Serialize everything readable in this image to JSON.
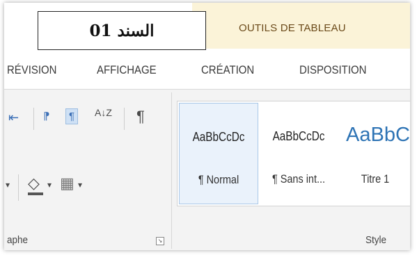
{
  "header": {
    "doc_label": "السند 01",
    "tools_title": "OUTILS DE TABLEAU"
  },
  "tabs": [
    {
      "label": "RÉVISION"
    },
    {
      "label": "AFFICHAGE"
    },
    {
      "label": "CRÉATION"
    },
    {
      "label": "DISPOSITION"
    }
  ],
  "paragraph_group": {
    "label": "aphe",
    "icons": {
      "decrease_indent": "⇤",
      "ltr": "⁋",
      "rtl": "¶",
      "sort": "A↓Z",
      "show_marks": "¶",
      "dropdown": "▾",
      "shading": "◇",
      "borders": "▦",
      "launcher": "↘"
    }
  },
  "styles_group": {
    "label": "Style",
    "items": [
      {
        "sample": "AaBbCcDc",
        "name": "¶ Normal",
        "selected": true
      },
      {
        "sample": "AaBbCcDc",
        "name": "¶ Sans int...",
        "selected": false
      },
      {
        "sample": "AaBbCc",
        "name": "Titre 1",
        "selected": false
      }
    ]
  },
  "colors": {
    "tools_band": "#fbf3d8",
    "accent_blue": "#2e74b5",
    "active_bg": "#cfe1f5"
  }
}
